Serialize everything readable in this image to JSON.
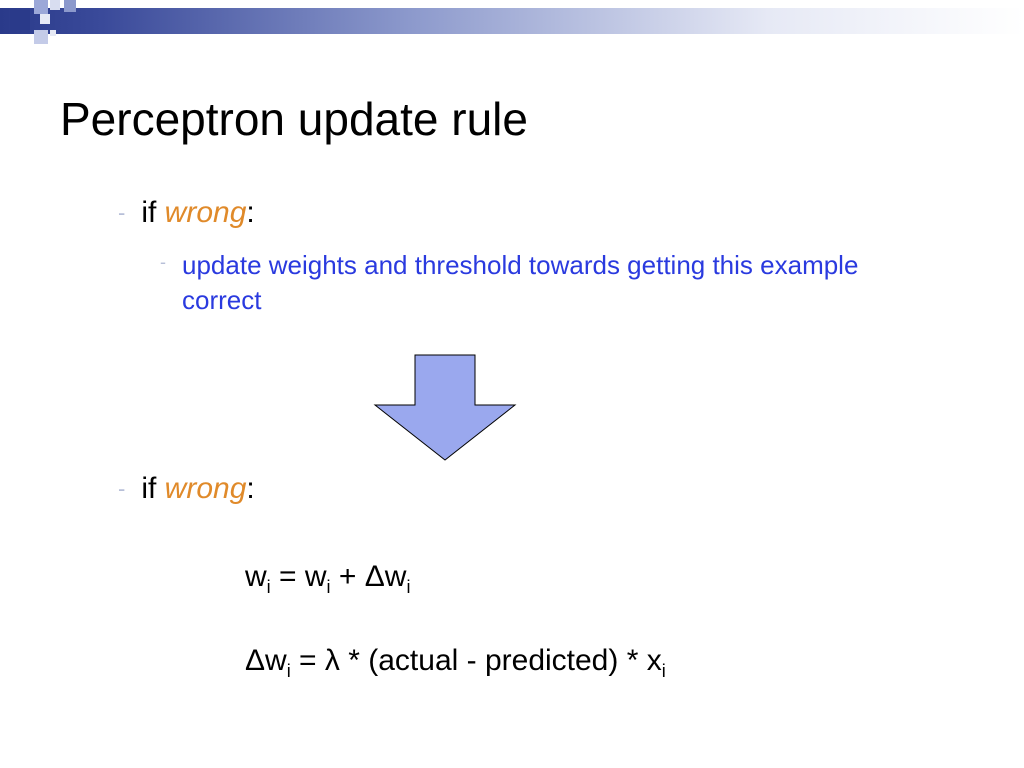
{
  "title": "Perceptron update rule",
  "bullet1": {
    "if_text": "if ",
    "wrong": "wrong",
    "colon": ":"
  },
  "bullet2": "update weights and threshold towards getting this example correct",
  "bullet3": {
    "if_text": "if ",
    "wrong": "wrong",
    "colon": ":"
  },
  "eq1": {
    "lhs_w": "w",
    "lhs_i": "i",
    "eq": " = ",
    "rhs_w": "w",
    "rhs_i": "i",
    "plus": " + ",
    "dw": "Δw",
    "dw_i": "i"
  },
  "eq2": {
    "dw": "Δw",
    "dw_i": "i",
    "eq": " = λ * (actual - predicted) * ",
    "x": "x",
    "x_i": "i"
  },
  "arrow": {
    "fill": "#9aa8ee",
    "stroke": "#000000"
  }
}
